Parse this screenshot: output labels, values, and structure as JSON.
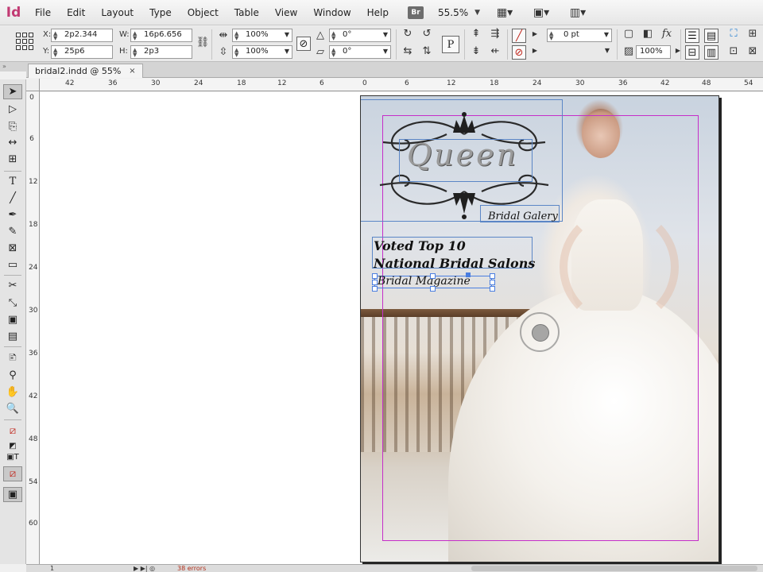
{
  "app": {
    "logo_text": "Id",
    "menus": [
      "File",
      "Edit",
      "Layout",
      "Type",
      "Object",
      "Table",
      "View",
      "Window",
      "Help"
    ],
    "bridge_badge": "Br",
    "zoom_level": "55.5%"
  },
  "control_bar": {
    "x_label": "X:",
    "x_value": "2p2.344",
    "y_label": "Y:",
    "y_value": "25p6",
    "w_label": "W:",
    "w_value": "16p6.656",
    "h_label": "H:",
    "h_value": "2p3",
    "scale_x": "100%",
    "scale_y": "100%",
    "rotate_angle": "0°",
    "shear_angle": "0°",
    "stroke_weight": "0 pt",
    "opacity": "100%",
    "paragraph_glyph": "P"
  },
  "document": {
    "tab_title": "bridal2.indd @ 55%",
    "close_glyph": "×"
  },
  "rulers": {
    "horizontal": [
      "42",
      "36",
      "30",
      "24",
      "18",
      "12",
      "6",
      "0",
      "6",
      "12",
      "18",
      "24",
      "30",
      "36",
      "42",
      "48",
      "54"
    ],
    "vertical": [
      "0",
      "6",
      "12",
      "18",
      "24",
      "30",
      "36",
      "42",
      "48",
      "54",
      "60"
    ]
  },
  "page_content": {
    "logo_title": "Queen",
    "logo_subtitle": "Bridal Galery",
    "headline_line1": "Voted Top 10",
    "headline_line2": "National Bridal Salons",
    "source_credit": "Bridal Magazine"
  },
  "status": {
    "page_number": "1",
    "errors": "38 errors"
  },
  "colors": {
    "app_accent": "#c23a73",
    "margin_guide": "#c52ec9",
    "frame_edge": "#5b86c6",
    "error_red": "#b2301c"
  }
}
